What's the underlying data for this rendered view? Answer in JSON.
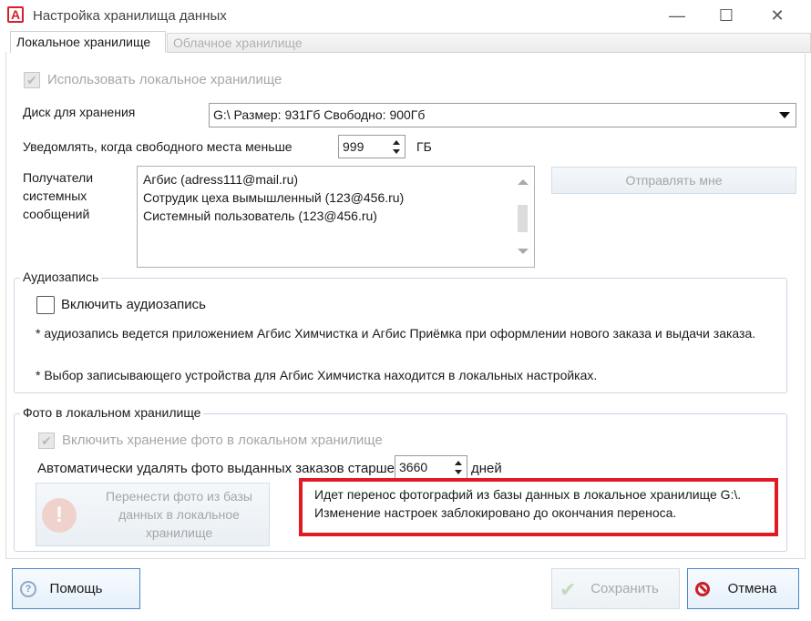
{
  "window": {
    "title": "Настройка хранилища данных",
    "minimize": "—",
    "maximize": "☐",
    "close": "✕"
  },
  "tabs": [
    {
      "label": "Локальное хранилище",
      "active": true
    },
    {
      "label": "Облачное хранилище",
      "active": false
    }
  ],
  "storage": {
    "use_local_label": "Использовать локальное хранилище",
    "use_local_checked": true,
    "disk_label": "Диск для хранения",
    "disk_value": "G:\\ Размер: 931Гб Свободно: 900Гб",
    "notify_label": "Уведомлять, когда свободного места меньше",
    "notify_value": "999",
    "notify_unit": "ГБ",
    "recipients_label": "Получатели системных сообщений",
    "recipients": [
      "Агбис (adress111@mail.ru)",
      "Сотрудик цеха вымышленный (123@456.ru)",
      "Системный пользователь (123@456.ru)"
    ],
    "send_me_button": "Отправлять мне"
  },
  "audio": {
    "group_title": "Аудиозапись",
    "enable_label": "Включить аудиозапись",
    "enable_checked": false,
    "note1": "* аудиозапись ведется приложением Агбис Химчистка и Агбис Приёмка при оформлении нового заказа и выдачи заказа.",
    "note2": "* Выбор записывающего устройства для Агбис Химчистка находится в локальных настройках."
  },
  "photos": {
    "group_title": "Фото в локальном хранилище",
    "enable_label": "Включить хранение фото в локальном хранилище",
    "enable_checked": true,
    "autodelete_label": "Автоматически удалять фото выданных заказов старше",
    "autodelete_value": "3660",
    "autodelete_unit": "дней",
    "transfer_button": "Перенести фото из базы данных в локальное хранилище",
    "transfer_message_line1": "Идет перенос фотографий из базы данных в локальное хранилище G:\\.",
    "transfer_message_line2": "Изменение настроек заблокировано  до окончания переноса."
  },
  "footer": {
    "help_button": "Помощь",
    "save_button": "Сохранить",
    "cancel_button": "Отмена"
  },
  "colors": {
    "highlight_border": "#e01b24",
    "brand": "#d81e2a"
  }
}
